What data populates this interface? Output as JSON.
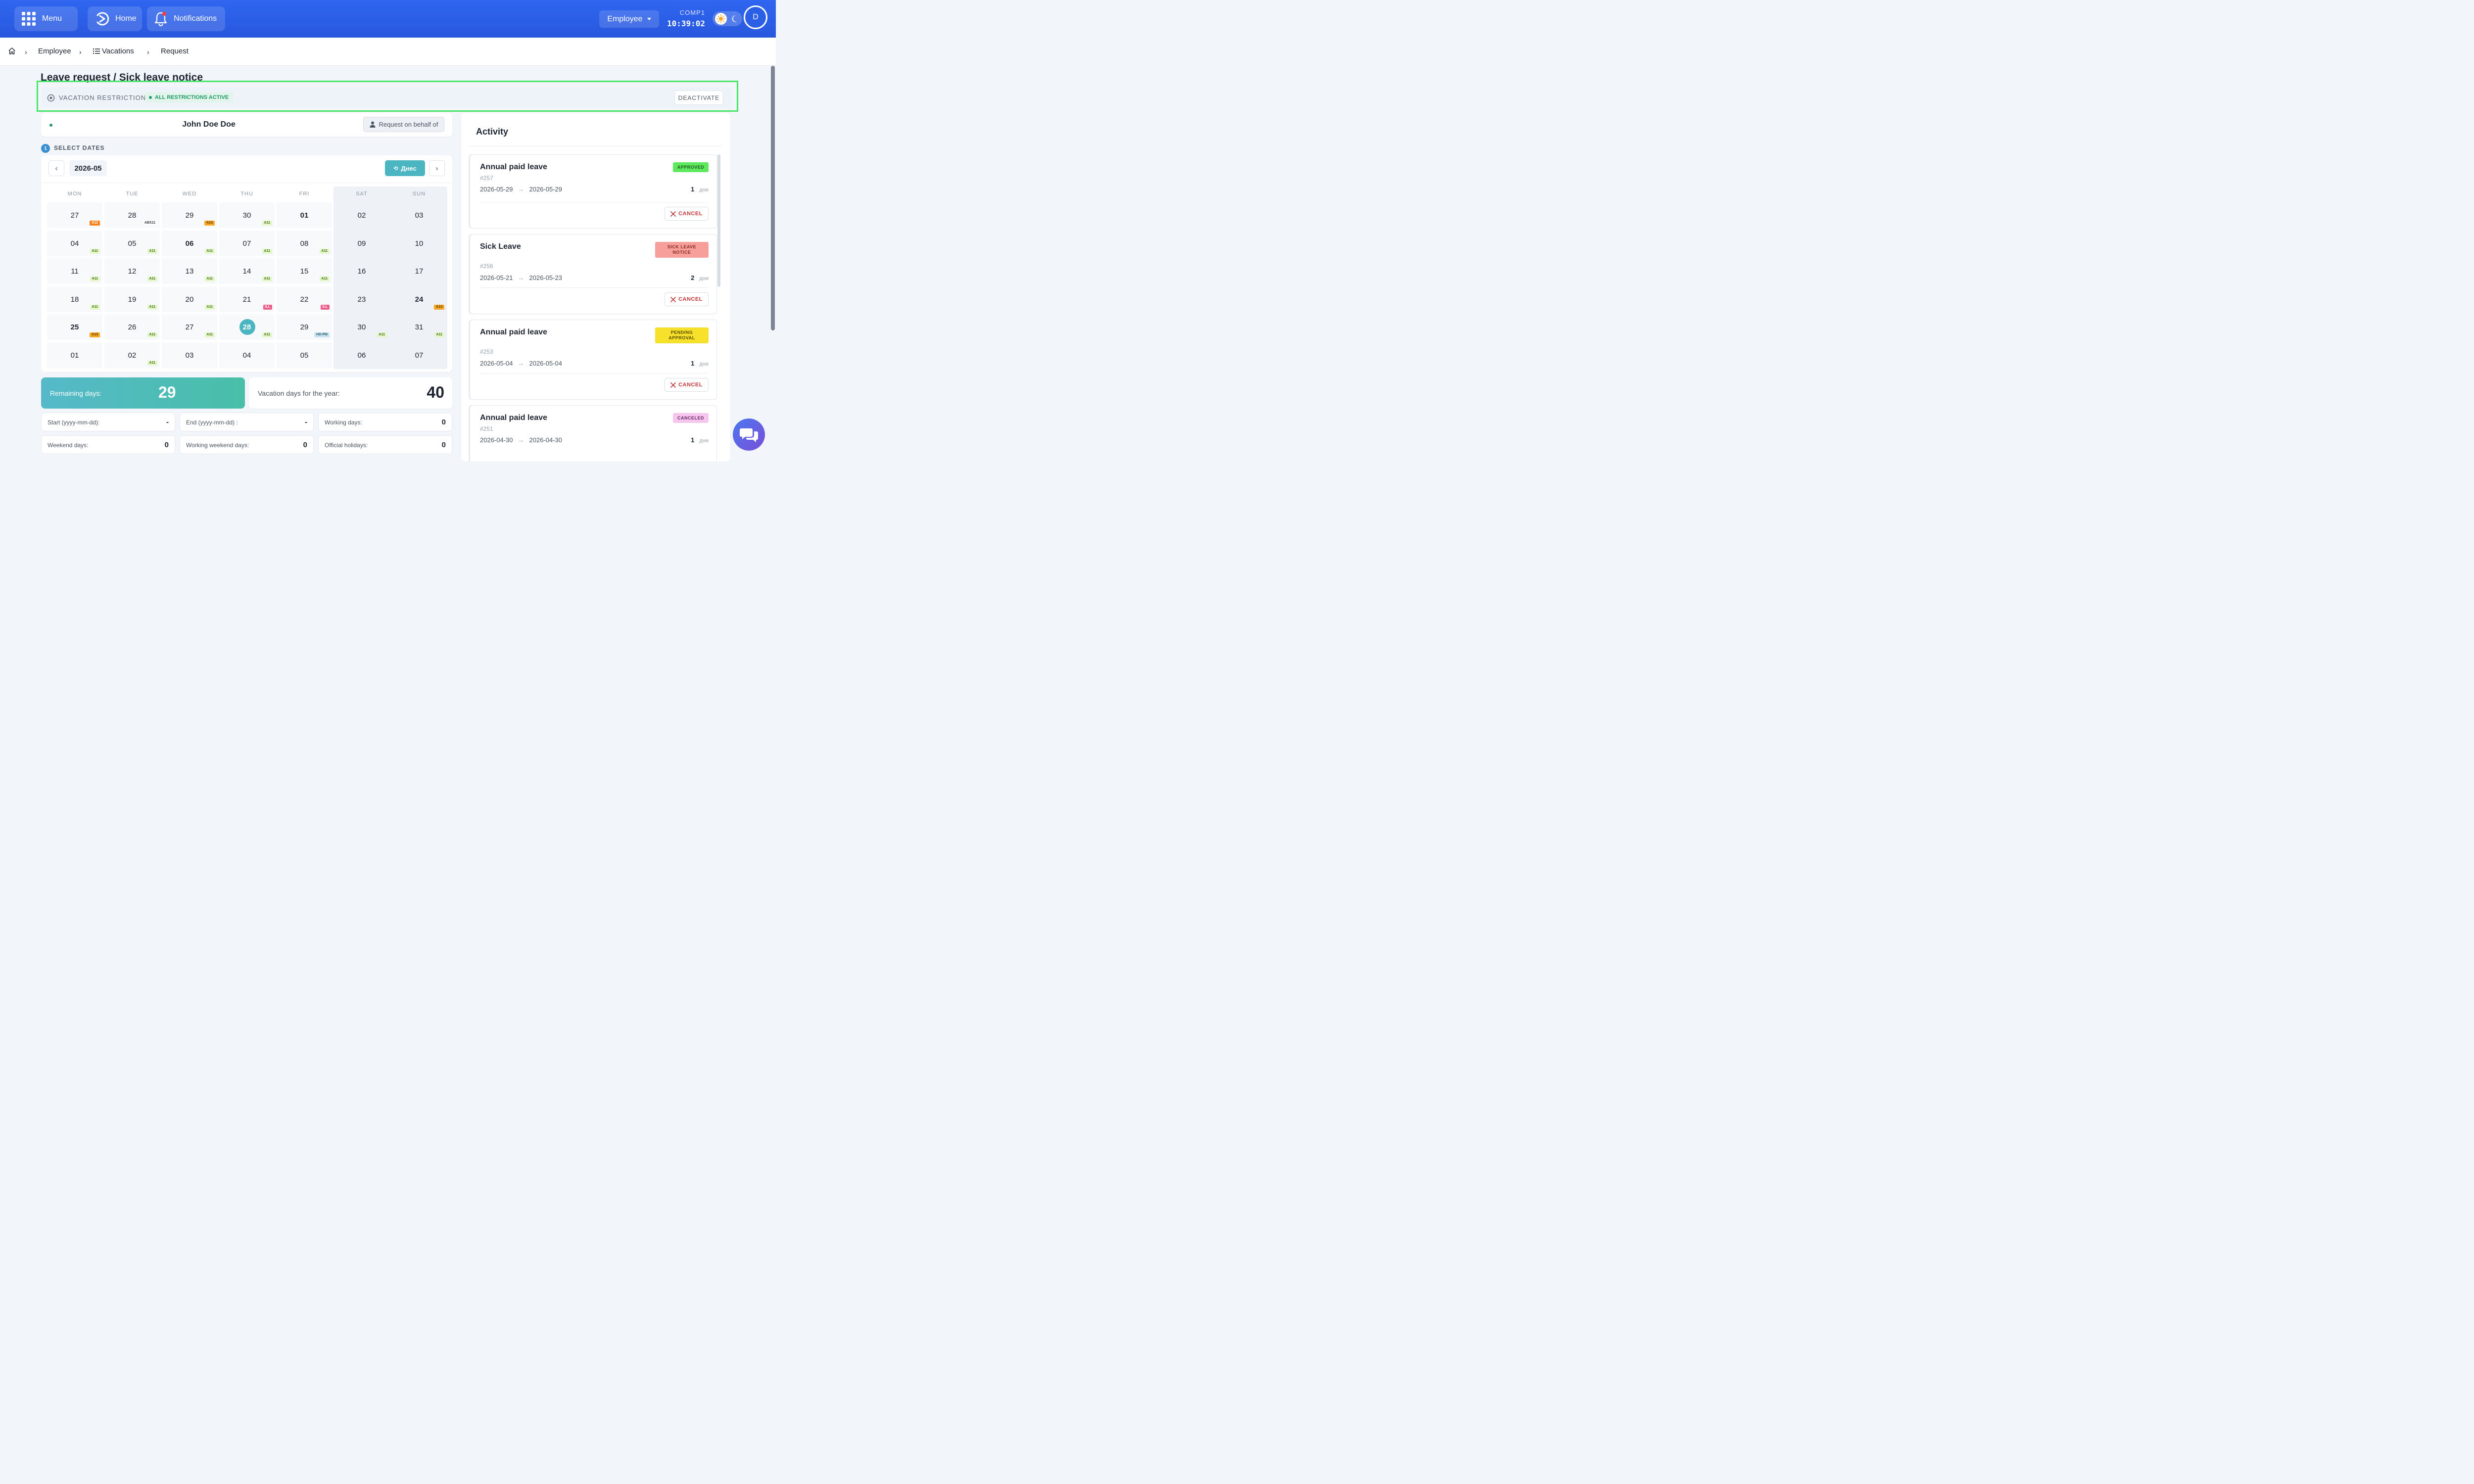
{
  "topbar": {
    "menu_label": "Menu",
    "home_label": "Home",
    "notifications_label": "Notifications",
    "role_dropdown": "Employee",
    "company": "COMP1",
    "clock": "10:39:02",
    "avatar_initial": "D",
    "brand_color": "#2f66f0"
  },
  "breadcrumb": {
    "items": [
      "Employee",
      "Vacations",
      "Request"
    ]
  },
  "page": {
    "title": "Leave request / Sick leave notice"
  },
  "restrictions": {
    "label": "VACATION RESTRICTIONS",
    "status": "ALL RESTRICTIONS ACTIVE",
    "button": "DEACTIVATE"
  },
  "employee": {
    "name": "John Doe Doe",
    "behalf_button": "Request on behalf of"
  },
  "calendar": {
    "step_number": "1",
    "step_label": "SELECT DATES",
    "prev": "‹",
    "next": "›",
    "month": "2026-05",
    "today_button": "Днес",
    "weekdays": [
      "MON",
      "TUE",
      "WED",
      "THU",
      "FRI",
      "SAT",
      "SUN"
    ],
    "weeks": [
      [
        {
          "d": "27",
          "tag": "A12"
        },
        {
          "d": "28",
          "tag": "ABS11"
        },
        {
          "d": "29",
          "tag": "A13"
        },
        {
          "d": "30",
          "tag": "A11"
        },
        {
          "d": "01",
          "bold": true
        },
        {
          "d": "02"
        },
        {
          "d": "03"
        }
      ],
      [
        {
          "d": "04",
          "tag": "A11"
        },
        {
          "d": "05",
          "tag": "A11"
        },
        {
          "d": "06",
          "tag": "A11",
          "bold": true
        },
        {
          "d": "07",
          "tag": "A11"
        },
        {
          "d": "08",
          "tag": "A11"
        },
        {
          "d": "09"
        },
        {
          "d": "10"
        }
      ],
      [
        {
          "d": "11",
          "tag": "A11"
        },
        {
          "d": "12",
          "tag": "A11"
        },
        {
          "d": "13",
          "tag": "A11"
        },
        {
          "d": "14",
          "tag": "A11"
        },
        {
          "d": "15",
          "tag": "A11"
        },
        {
          "d": "16"
        },
        {
          "d": "17"
        }
      ],
      [
        {
          "d": "18",
          "tag": "A11"
        },
        {
          "d": "19",
          "tag": "A11"
        },
        {
          "d": "20",
          "tag": "A11"
        },
        {
          "d": "21",
          "tag": "ILL"
        },
        {
          "d": "22",
          "tag": "ILL"
        },
        {
          "d": "23"
        },
        {
          "d": "24",
          "tag": "A13",
          "bold": true
        }
      ],
      [
        {
          "d": "25",
          "tag": "A13",
          "bold": true
        },
        {
          "d": "26",
          "tag": "A11"
        },
        {
          "d": "27",
          "tag": "A11"
        },
        {
          "d": "28",
          "tag": "A11",
          "today": true
        },
        {
          "d": "29",
          "tag": "HD-PM"
        },
        {
          "d": "30",
          "tag": "A11"
        },
        {
          "d": "31",
          "tag": "A11"
        }
      ],
      [
        {
          "d": "01"
        },
        {
          "d": "02",
          "tag": "A11"
        },
        {
          "d": "03"
        },
        {
          "d": "04"
        },
        {
          "d": "05"
        },
        {
          "d": "06"
        },
        {
          "d": "07"
        }
      ]
    ],
    "tag_colors": {
      "A11": {
        "bg": "#e4f7c9",
        "fg": "#3d6b14"
      },
      "A12": {
        "bg": "#f7821b",
        "fg": "#ffffff"
      },
      "A13": {
        "bg": "#f5a623",
        "fg": "#5a3a00"
      },
      "ABS11": {
        "bg": "#ffffff",
        "fg": "#333333"
      },
      "ILL": {
        "bg": "#ec5f8a",
        "fg": "#ffffff"
      },
      "HD-PM": {
        "bg": "#c9e4ee",
        "fg": "#2b5f73"
      }
    }
  },
  "summary": {
    "remaining_label": "Remaining days:",
    "remaining_value": "29",
    "year_label": "Vacation days for the year:",
    "year_value": "40",
    "stats": [
      {
        "label": "Start (yyyy-mm-dd):",
        "value": "-"
      },
      {
        "label": "End (yyyy-mm-dd) :",
        "value": "-"
      },
      {
        "label": "Working days:",
        "value": "0"
      },
      {
        "label": "Weekend days:",
        "value": "0"
      },
      {
        "label": "Working weekend days:",
        "value": "0"
      },
      {
        "label": "Official holidays:",
        "value": "0"
      }
    ]
  },
  "activity": {
    "title": "Activity",
    "cancel_label": "CANCEL",
    "days_unit": "дни",
    "items": [
      {
        "title": "Annual paid leave",
        "status": "APPROVED",
        "status_bg": "#5ee85e",
        "status_fg": "#1f5a1f",
        "id": "#257",
        "from": "2026-05-29",
        "to": "2026-05-29",
        "days": "1"
      },
      {
        "title": "Sick Leave",
        "status": "SICK LEAVE NOTICE",
        "status_bg": "#f7a09b",
        "status_fg": "#8c2a22",
        "id": "#256",
        "from": "2026-05-21",
        "to": "2026-05-23",
        "days": "2"
      },
      {
        "title": "Annual paid leave",
        "status": "PENDING APPROVAL",
        "status_bg": "#f7e12a",
        "status_fg": "#5a4b00",
        "id": "#253",
        "from": "2026-05-04",
        "to": "2026-05-04",
        "days": "1"
      },
      {
        "title": "Annual paid leave",
        "status": "CANCELED",
        "status_bg": "#f6c6ee",
        "status_fg": "#6b2a63",
        "id": "#251",
        "from": "2026-04-30",
        "to": "2026-04-30",
        "days": "1"
      }
    ]
  }
}
